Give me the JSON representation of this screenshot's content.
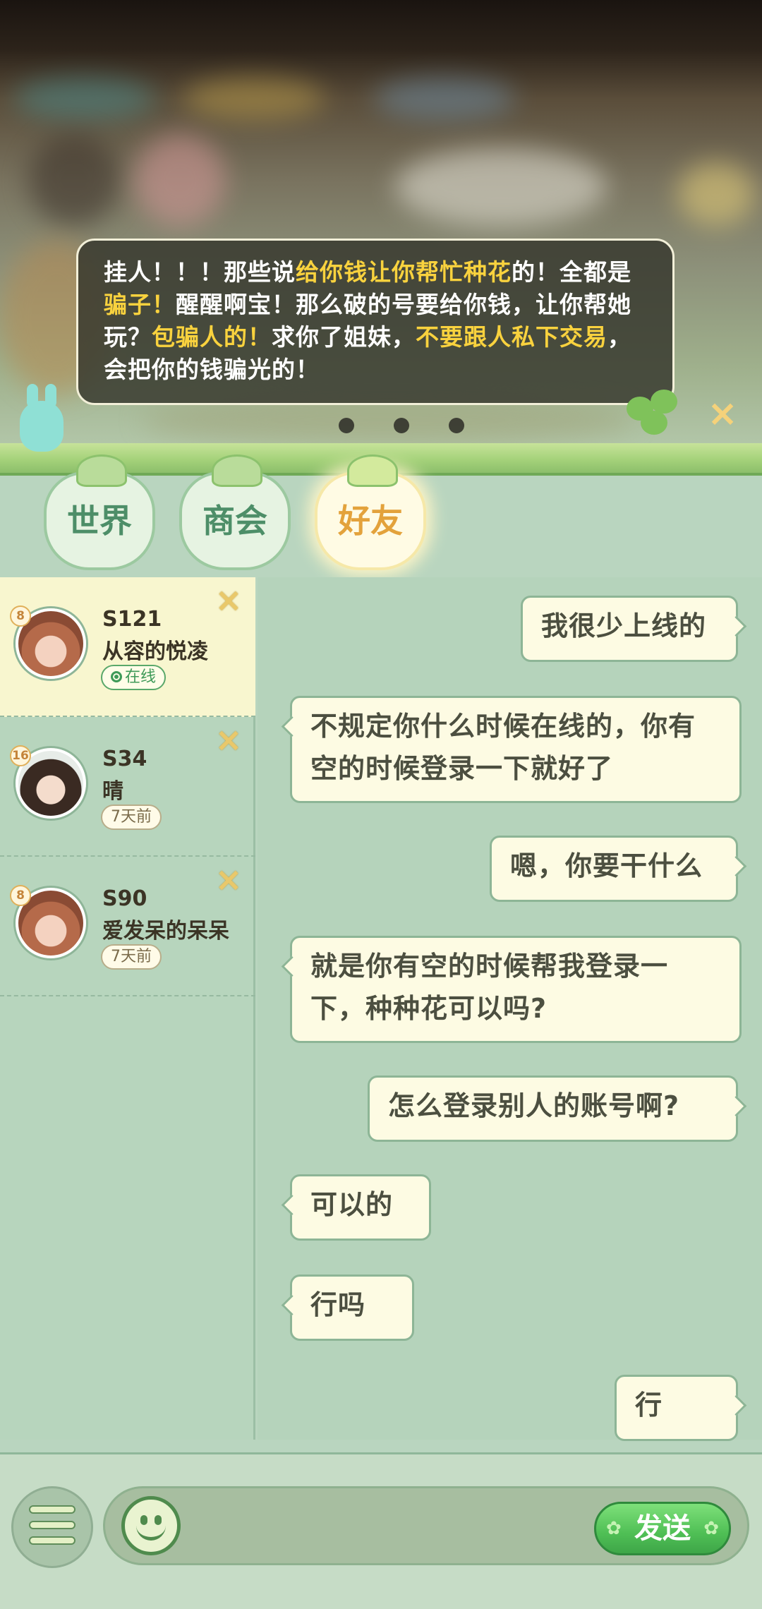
{
  "notice": {
    "segments": [
      {
        "text": "挂人！！！那些说",
        "hl": false
      },
      {
        "text": "给你钱让你帮忙种花",
        "hl": true
      },
      {
        "text": "的！全都是",
        "hl": false
      },
      {
        "text": "骗子！",
        "hl": true
      },
      {
        "text": "醒醒啊宝！那么破的号要给你钱，让你帮她玩？",
        "hl": false
      },
      {
        "text": "包骗人的！",
        "hl": true
      },
      {
        "text": "求你了姐妹，",
        "hl": false
      },
      {
        "text": "不要跟人私下交易",
        "hl": true
      },
      {
        "text": "，会把你的钱骗光的！",
        "hl": false
      }
    ],
    "close_icon": "×"
  },
  "tabs": [
    {
      "label": "世界",
      "active": false
    },
    {
      "label": "商会",
      "active": false
    },
    {
      "label": "好友",
      "active": true
    }
  ],
  "friends": [
    {
      "level": "8",
      "server": "S121",
      "name": "从容的悦凌",
      "status": "在线",
      "online": true,
      "selected": true
    },
    {
      "level": "16",
      "server": "S34",
      "name": "晴",
      "status": "7天前",
      "online": false,
      "selected": false
    },
    {
      "level": "8",
      "server": "S90",
      "name": "爱发呆的呆呆",
      "status": "7天前",
      "online": false,
      "selected": false
    }
  ],
  "messages": [
    {
      "side": "right",
      "text": "我很少上线的"
    },
    {
      "side": "left",
      "text": "不规定你什么时候在线的，你有空的时候登录一下就好了"
    },
    {
      "side": "right",
      "text": "嗯，你要干什么"
    },
    {
      "side": "left",
      "text": "就是你有空的时候帮我登录一下，种种花可以吗?"
    },
    {
      "side": "right",
      "text": "怎么登录别人的账号啊?"
    },
    {
      "side": "left",
      "text": "可以的"
    },
    {
      "side": "left",
      "text": "行吗"
    },
    {
      "side": "right",
      "text": "行"
    }
  ],
  "input": {
    "send_label": "发送"
  },
  "icons": {
    "menu": "menu-icon",
    "emoji": "smiley-icon",
    "close": "close-icon"
  },
  "colors": {
    "highlight": "#f9d23e",
    "active_tab_text": "#e3a23b",
    "send_button": "#4fbf55"
  }
}
